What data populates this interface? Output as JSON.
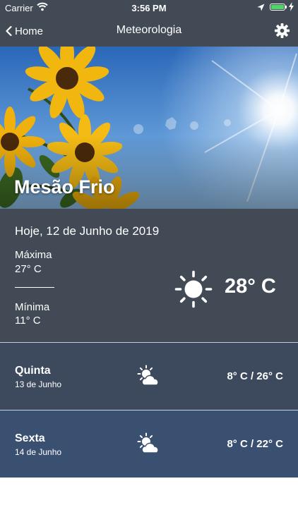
{
  "status_bar": {
    "carrier": "Carrier",
    "time": "3:56 PM"
  },
  "nav": {
    "back_label": "Home",
    "title": "Meteorologia"
  },
  "hero": {
    "city": "Mesão Frio"
  },
  "today": {
    "date": "Hoje, 12 de Junho de 2019",
    "max_label": "Máxima",
    "max_value": "27° C",
    "min_label": "Mínima",
    "min_value": "11° C",
    "current_temp": "28° C",
    "icon": "sun-icon"
  },
  "forecast": [
    {
      "day": "Quinta",
      "date": "13 de Junho",
      "temps": "8° C / 26° C",
      "icon": "partly-cloudy-icon"
    },
    {
      "day": "Sexta",
      "date": "14 de Junho",
      "temps": "8° C / 22° C",
      "icon": "partly-cloudy-icon"
    }
  ],
  "colors": {
    "bar_background": "#414a55",
    "row1_background": "#3d4a5d",
    "row2_background": "#3a5070",
    "battery_green": "#4cd964"
  }
}
